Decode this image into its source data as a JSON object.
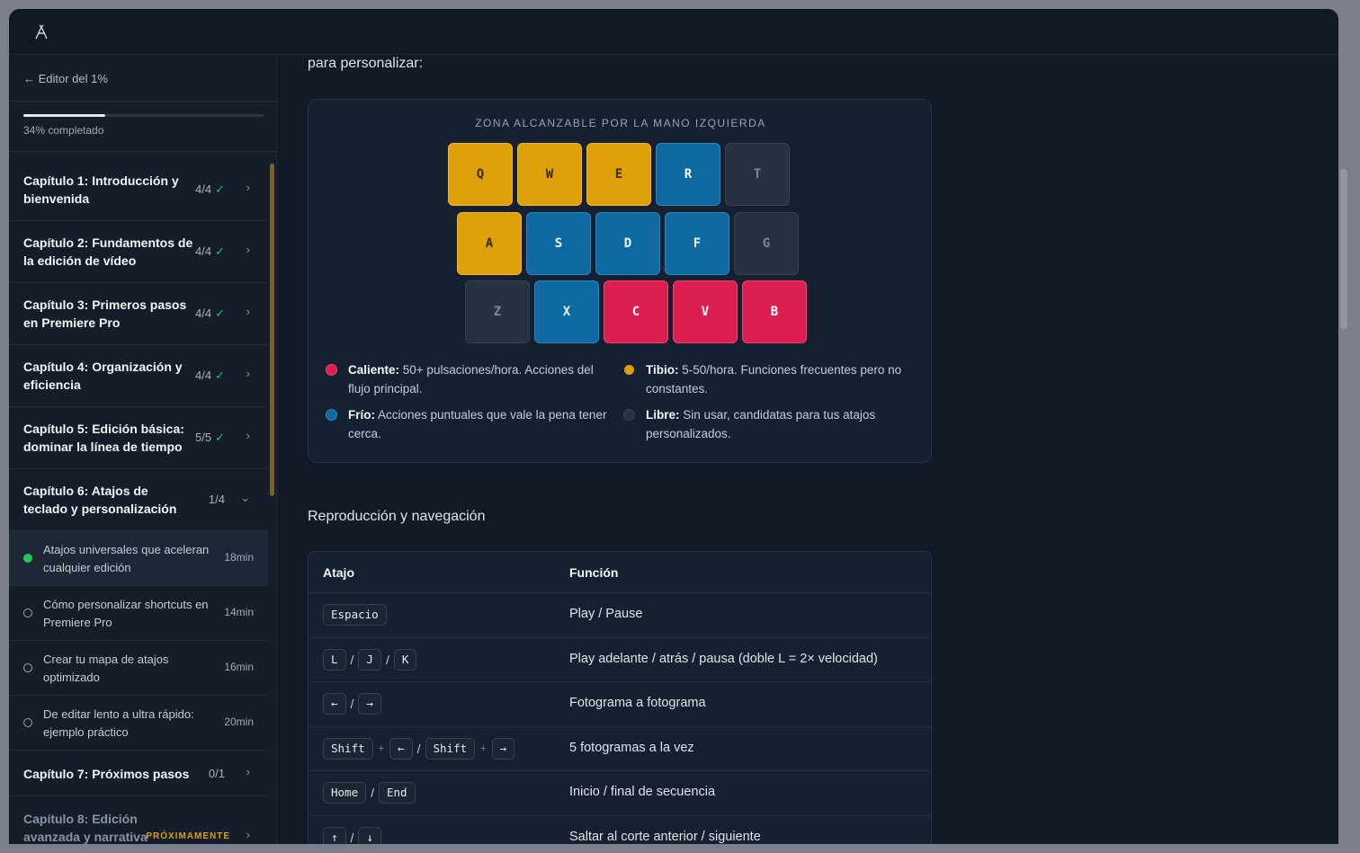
{
  "colors": {
    "hot": "#dc1f50",
    "warm": "#dfa10a",
    "cold": "#0e6aa1",
    "free": "#283142",
    "done": "#22c55e"
  },
  "sidebar": {
    "back_label": "← Editor del 1%",
    "progress_pct": 34,
    "progress_label": "34% completado",
    "chapters": [
      {
        "title": "Capítulo 1: Introducción y bienvenida",
        "count": "4/4",
        "done": "✓"
      },
      {
        "title": "Capítulo 2: Fundamentos de la edición de vídeo",
        "count": "4/4",
        "done": "✓"
      },
      {
        "title": "Capítulo 3: Primeros pasos en Premiere Pro",
        "count": "4/4",
        "done": "✓"
      },
      {
        "title": "Capítulo 4: Organización y eficiencia",
        "count": "4/4",
        "done": "✓"
      },
      {
        "title": "Capítulo 5: Edición básica: dominar la línea de tiempo",
        "count": "5/5",
        "done": "✓"
      },
      {
        "title": "Capítulo 6: Atajos de teclado y personalización",
        "count": "1/4"
      }
    ],
    "lessons": [
      {
        "title": "Atajos universales que aceleran cualquier edición",
        "duration": "18min"
      },
      {
        "title": "Cómo personalizar shortcuts en Premiere Pro",
        "duration": "14min"
      },
      {
        "title": "Crear tu mapa de atajos optimizado",
        "duration": "16min"
      },
      {
        "title": "De editar lento a ultra rápido: ejemplo práctico",
        "duration": "20min"
      }
    ],
    "chapter7": {
      "title": "Capítulo 7: Próximos pasos",
      "count": "0/1"
    },
    "chapter8": {
      "title": "Capítulo 8: Edición avanzada y narrativa",
      "badge": "PRÓXIMAMENTE"
    }
  },
  "main": {
    "lead": "para personalizar:",
    "keyboard": {
      "title": "ZONA ALCANZABLE POR LA MANO IZQUIERDA",
      "rows": [
        [
          {
            "k": "Q",
            "t": "warm"
          },
          {
            "k": "W",
            "t": "warm"
          },
          {
            "k": "E",
            "t": "warm"
          },
          {
            "k": "R",
            "t": "cold"
          },
          {
            "k": "T",
            "t": "free"
          }
        ],
        [
          {
            "k": "A",
            "t": "warm"
          },
          {
            "k": "S",
            "t": "cold"
          },
          {
            "k": "D",
            "t": "cold"
          },
          {
            "k": "F",
            "t": "cold"
          },
          {
            "k": "G",
            "t": "free"
          }
        ],
        [
          {
            "k": "Z",
            "t": "free"
          },
          {
            "k": "X",
            "t": "cold"
          },
          {
            "k": "C",
            "t": "hot"
          },
          {
            "k": "V",
            "t": "hot"
          },
          {
            "k": "B",
            "t": "hot"
          }
        ]
      ]
    },
    "legend": [
      {
        "label": "Caliente:",
        "text": "50+ pulsaciones/hora. Acciones del flujo principal."
      },
      {
        "label": "Tibio:",
        "text": "5-50/hora. Funciones frecuentes pero no constantes."
      },
      {
        "label": "Frío:",
        "text": "Acciones puntuales que vale la pena tener cerca."
      },
      {
        "label": "Libre:",
        "text": "Sin usar, candidatas para tus atajos personalizados."
      }
    ],
    "section_title": "Reproducción y navegación",
    "table": {
      "headers": {
        "shortcut": "Atajo",
        "function": "Función"
      },
      "rows": [
        {
          "keys": [
            "Espacio"
          ],
          "seps": [],
          "func": "Play / Pause"
        },
        {
          "keys": [
            "L",
            "J",
            "K"
          ],
          "seps": [
            "/",
            "/"
          ],
          "func": "Play adelante / atrás / pausa (doble L = 2× velocidad)"
        },
        {
          "keys": [
            "←",
            "→"
          ],
          "seps": [
            "/"
          ],
          "func": "Fotograma a fotograma"
        },
        {
          "keys": [
            "Shift",
            "←",
            "Shift",
            "→"
          ],
          "seps": [
            "+",
            "/",
            "+"
          ],
          "func": "5 fotogramas a la vez"
        },
        {
          "keys": [
            "Home",
            "End"
          ],
          "seps": [
            "/"
          ],
          "func": "Inicio / final de secuencia"
        },
        {
          "keys": [
            "↑",
            "↓"
          ],
          "seps": [
            "/"
          ],
          "func": "Saltar al corte anterior / siguiente"
        }
      ]
    }
  }
}
